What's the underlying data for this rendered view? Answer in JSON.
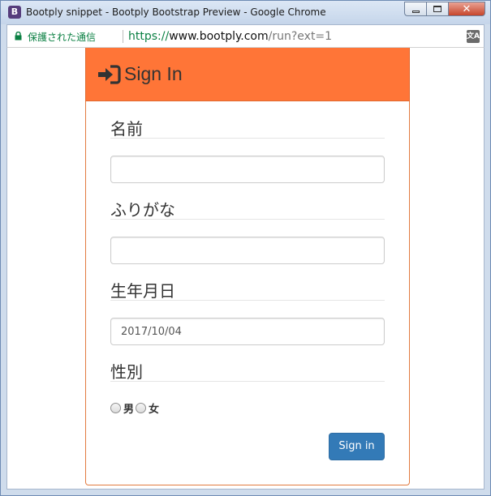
{
  "window": {
    "title": "Bootply snippet - Bootply Bootstrap Preview - Google Chrome",
    "app_icon_letter": "B"
  },
  "addressbar": {
    "secure_text": "保護された通信",
    "url_protocol": "https://",
    "url_host": "www.bootply.com",
    "url_path": "/run?ext=1",
    "translate_icon_glyph": "文A"
  },
  "icons": {
    "signin": "sign-in-icon",
    "lock": "lock-icon",
    "translate": "translate-icon"
  },
  "form": {
    "header_title": "Sign In",
    "header_color": "#ff7537",
    "fields": [
      {
        "legend": "名前",
        "value": ""
      },
      {
        "legend": "ふりがな",
        "value": ""
      },
      {
        "legend": "生年月日",
        "value": "2017/10/04"
      }
    ],
    "gender": {
      "legend": "性別",
      "options": [
        "男",
        "女"
      ]
    },
    "submit_label": "Sign in",
    "submit_color": "#337ab7"
  }
}
